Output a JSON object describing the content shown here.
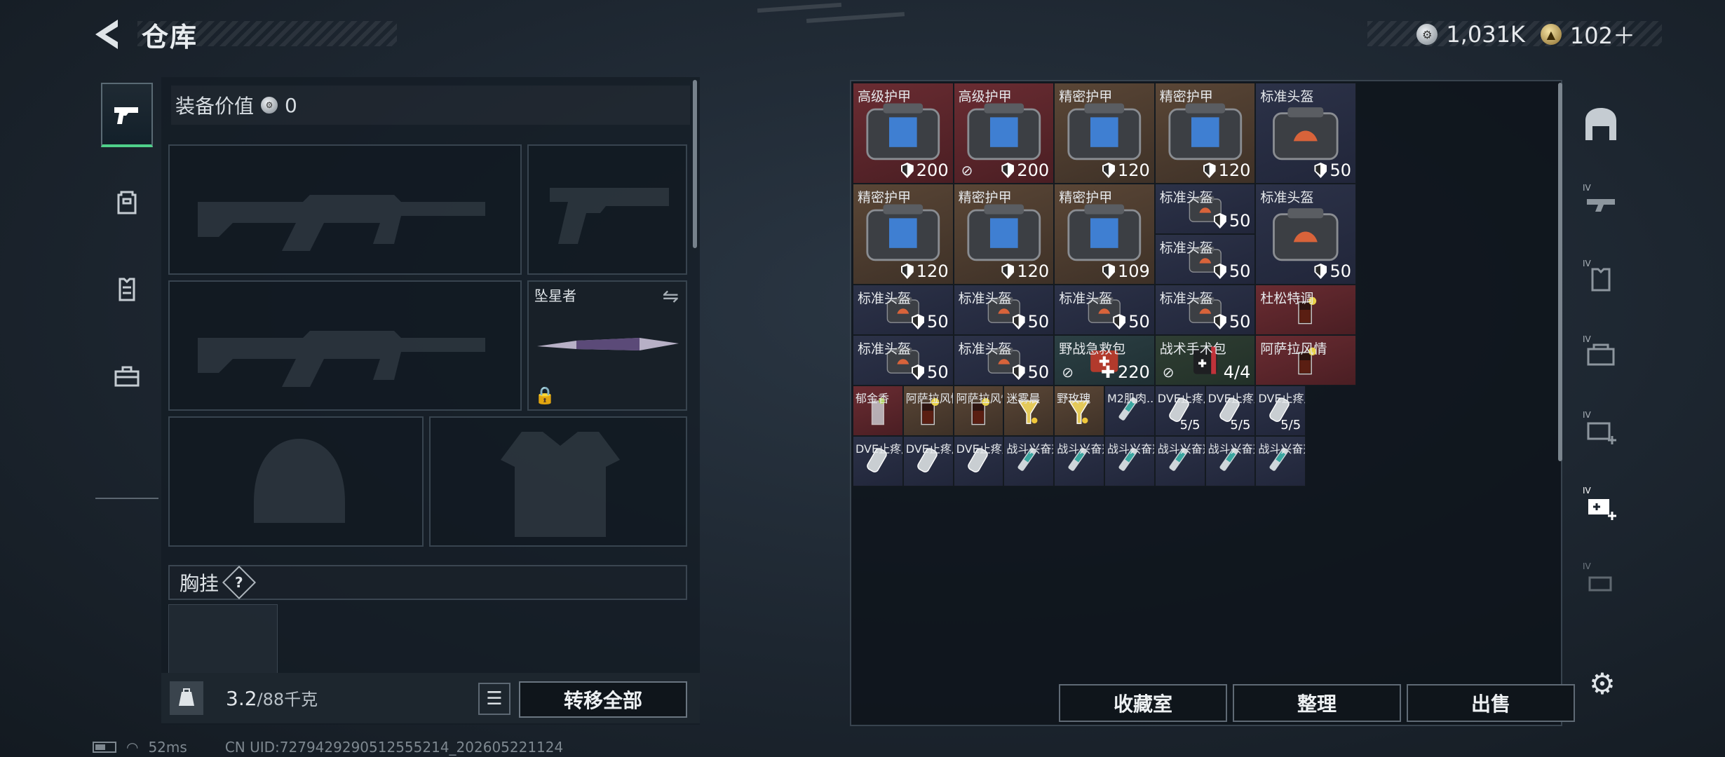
{
  "header": {
    "title": "仓库",
    "silver": "1,031K",
    "gold": "102＋"
  },
  "loadout": {
    "equipment_value_label": "装备价值",
    "equipment_value": "0",
    "melee_name": "坠星者",
    "chest_rig_label": "胸挂",
    "help": "?",
    "weight_value": "3.2",
    "weight_max": "/88千克",
    "transfer_all": "转移全部"
  },
  "storage": {
    "items": [
      {
        "name": "高级护甲",
        "value": "200",
        "type": "armor",
        "rarity": "red"
      },
      {
        "name": "高级护甲",
        "value": "200",
        "type": "armor",
        "rarity": "red",
        "locked": true
      },
      {
        "name": "精密护甲",
        "value": "120",
        "type": "armor",
        "rarity": "brown"
      },
      {
        "name": "精密护甲",
        "value": "120",
        "type": "armor",
        "rarity": "brown"
      },
      {
        "name": "标准头盔",
        "value": "50",
        "type": "helmet",
        "rarity": "blue"
      },
      {
        "name": "精密护甲",
        "value": "120",
        "type": "armor",
        "rarity": "brown"
      },
      {
        "name": "精密护甲",
        "value": "120",
        "type": "armor",
        "rarity": "brown"
      },
      {
        "name": "精密护甲",
        "value": "109",
        "type": "armor",
        "rarity": "brown"
      },
      {
        "name": "标准头盔",
        "value": "50",
        "type": "helmet",
        "rarity": "blue"
      },
      {
        "name": "标准头盔",
        "value": "50",
        "type": "helmet",
        "rarity": "blue"
      },
      {
        "name": "标准头盔",
        "value": "50",
        "type": "helmet",
        "rarity": "blue"
      },
      {
        "name": "标准头盔",
        "value": "50",
        "type": "helmet",
        "rarity": "blue"
      },
      {
        "name": "标准头盔",
        "value": "50",
        "type": "helmet",
        "rarity": "blue"
      },
      {
        "name": "标准头盔",
        "value": "50",
        "type": "helmet",
        "rarity": "blue"
      },
      {
        "name": "标准头盔",
        "value": "50",
        "type": "helmet",
        "rarity": "blue"
      },
      {
        "name": "杜松特调",
        "value": "",
        "type": "drink",
        "rarity": "red"
      },
      {
        "name": "标准头盔",
        "value": "50",
        "type": "helmet",
        "rarity": "blue"
      },
      {
        "name": "标准头盔",
        "value": "50",
        "type": "helmet",
        "rarity": "blue"
      },
      {
        "name": "野战急救包",
        "value": "220",
        "type": "medkit",
        "rarity": "teal",
        "locked": true
      },
      {
        "name": "战术手术包",
        "value": "4/4",
        "type": "surgery",
        "rarity": "green",
        "locked": true
      },
      {
        "name": "阿萨拉风情",
        "value": "",
        "type": "drink",
        "rarity": "red"
      },
      {
        "name": "郁金香",
        "value": "",
        "type": "glass",
        "rarity": "red"
      },
      {
        "name": "阿萨拉风情",
        "value": "",
        "type": "drink",
        "rarity": "brown"
      },
      {
        "name": "阿萨拉风情",
        "value": "",
        "type": "drink",
        "rarity": "brown"
      },
      {
        "name": "迷雾晨",
        "value": "",
        "type": "cocktail",
        "rarity": "brown"
      },
      {
        "name": "野玫瑰",
        "value": "",
        "type": "cocktail",
        "rarity": "brown"
      },
      {
        "name": "M2肌肉...",
        "value": "",
        "type": "syringe",
        "rarity": "blue"
      },
      {
        "name": "DVE止疼片",
        "value": "5/5",
        "type": "pills",
        "rarity": "blue"
      },
      {
        "name": "DVE止疼片",
        "value": "5/5",
        "type": "pills",
        "rarity": "blue"
      },
      {
        "name": "DVE止疼片",
        "value": "5/5",
        "type": "pills",
        "rarity": "blue"
      },
      {
        "name": "DVE止疼片",
        "value": "",
        "type": "pills",
        "rarity": "blue"
      },
      {
        "name": "DVE止疼片",
        "value": "",
        "type": "pills",
        "rarity": "blue"
      },
      {
        "name": "DVE止疼片",
        "value": "",
        "type": "pills",
        "rarity": "blue"
      },
      {
        "name": "战斗兴奋剂",
        "value": "",
        "type": "syringe",
        "rarity": "blue"
      },
      {
        "name": "战斗兴奋剂",
        "value": "",
        "type": "syringe",
        "rarity": "blue"
      },
      {
        "name": "战斗兴奋剂",
        "value": "",
        "type": "syringe",
        "rarity": "blue"
      },
      {
        "name": "战斗兴奋剂",
        "value": "",
        "type": "syringe",
        "rarity": "blue"
      },
      {
        "name": "战斗兴奋剂",
        "value": "",
        "type": "syringe",
        "rarity": "blue"
      },
      {
        "name": "战斗兴奋剂",
        "value": "",
        "type": "syringe",
        "rarity": "blue"
      }
    ],
    "buttons": {
      "collection": "收藏室",
      "organize": "整理",
      "sell": "出售"
    }
  },
  "status": {
    "ping": "52ms",
    "uid": "CN UID:7279429290512555214_202605221124"
  },
  "colors": {
    "accent_green": "#4fd08a",
    "rarity_red": "#6a2c32",
    "rarity_brown": "#5a4636",
    "rarity_blue": "#2c3248"
  },
  "icons": [
    "back-arrow-icon",
    "silver-coin-icon",
    "gold-coin-icon",
    "pistol-icon",
    "backpack-icon",
    "vest-icon",
    "toolbox-icon",
    "lock-icon",
    "swap-icon",
    "shield-icon",
    "list-icon",
    "gear-icon"
  ]
}
